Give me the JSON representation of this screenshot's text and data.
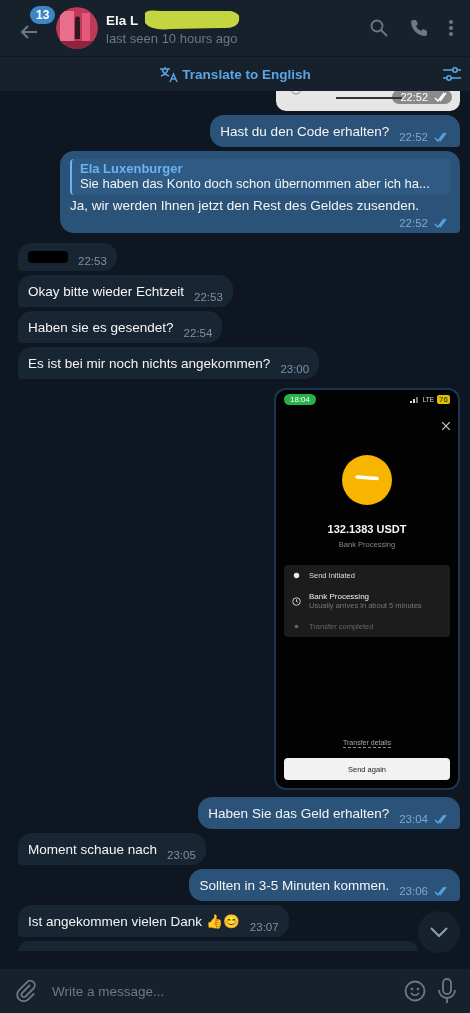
{
  "header": {
    "unread_badge": "13",
    "name": "Ela L",
    "status": "last seen 10 hours ago"
  },
  "translate_bar": {
    "label": "Translate to English"
  },
  "messages": [
    {
      "kind": "partial_image",
      "outgoing": true,
      "time": "22:52",
      "read": true
    },
    {
      "kind": "text",
      "outgoing": true,
      "text": "Hast du den Code erhalten?",
      "time": "22:52",
      "read": true
    },
    {
      "kind": "reply",
      "outgoing": true,
      "reply_author": "Ela Luxenburger",
      "reply_text": "Sie haben das Konto doch schon übernommen aber ich ha...",
      "text": "Ja, wir werden Ihnen jetzt den Rest des Geldes zusenden.",
      "time": "22:52",
      "read": true
    },
    {
      "kind": "redacted",
      "outgoing": false,
      "time": "22:53"
    },
    {
      "kind": "text",
      "outgoing": false,
      "text": "Okay bitte wieder Echtzeit",
      "time": "22:53"
    },
    {
      "kind": "text",
      "outgoing": false,
      "text": "Haben sie es gesendet?",
      "time": "22:54"
    },
    {
      "kind": "text",
      "outgoing": false,
      "text": "Es ist bei mir noch nichts angekommen?",
      "time": "23:00"
    },
    {
      "outgoing": true,
      "screen": {
        "clock": "18:04",
        "network": "LTE",
        "battery": "76",
        "amount": "132.1383 USDT",
        "status": "Bank Processing",
        "steps": [
          {
            "kind": "done",
            "label": "Send Initiated"
          },
          {
            "kind": "active",
            "label": "Bank Processing",
            "note": "Usually arrives in about 5 minutes"
          },
          {
            "kind": "pending",
            "label": "Transfer completed"
          }
        ],
        "details_link": "Transfer details",
        "button": "Send again"
      }
    },
    {
      "kind": "text",
      "outgoing": true,
      "text": "Haben Sie das Geld erhalten?",
      "time": "23:04",
      "read": true
    },
    {
      "kind": "text",
      "outgoing": false,
      "text": "Moment schaue nach",
      "time": "23:05"
    },
    {
      "kind": "text",
      "outgoing": true,
      "text": "Sollten in 3-5 Minuten kommen.",
      "time": "23:06",
      "read": true
    },
    {
      "kind": "text",
      "outgoing": false,
      "text": "Ist angekommen vielen Dank 👍😊",
      "time": "23:07"
    },
    {
      "kind": "partial",
      "outgoing": false
    }
  ],
  "composer": {
    "placeholder": "Write a message..."
  }
}
